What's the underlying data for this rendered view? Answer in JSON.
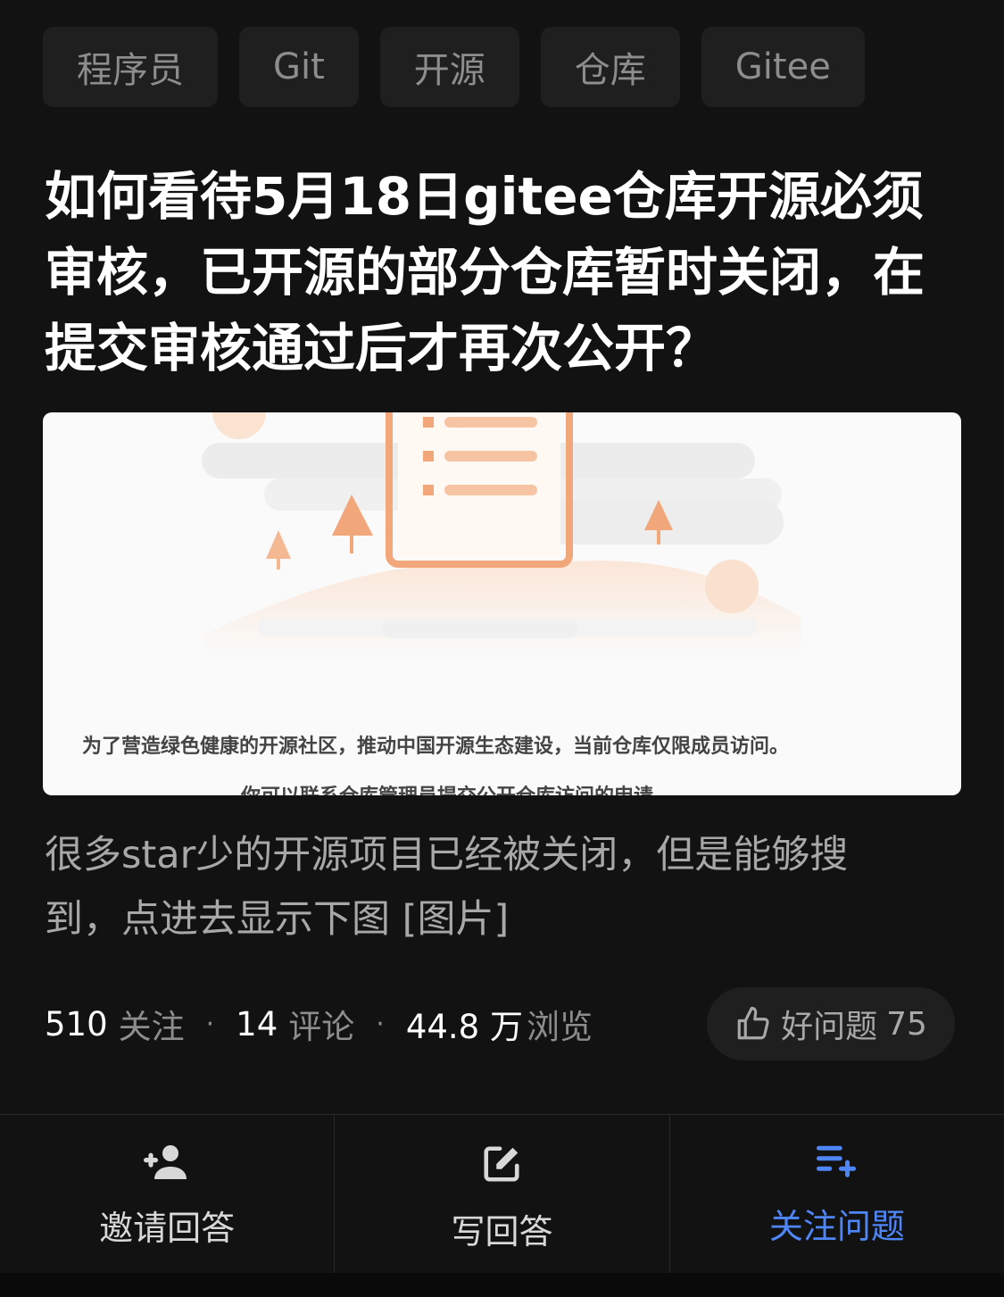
{
  "tags": [
    "程序员",
    "Git",
    "开源",
    "仓库",
    "Gitee"
  ],
  "question": {
    "title": "如何看待5月18日gitee仓库开源必须审核，已开源的部分仓库暂时关闭，在提交审核通过后才再次公开？"
  },
  "image": {
    "line1": "为了营造绿色健康的开源社区，推动中国开源生态建设，当前仓库仅限成员访问。",
    "line2": "你可以联系仓库管理员提交公开仓库访问的申请"
  },
  "excerpt": "很多star少的开源项目已经被关闭，但是能够搜到，点进去显示下图 [图片]",
  "stats": {
    "followers": "510",
    "followers_label": "关注",
    "comments": "14",
    "comments_label": "评论",
    "views": "44.8 万",
    "views_label": "浏览"
  },
  "good_question": {
    "label": "好问题",
    "count": "75"
  },
  "actions": {
    "invite": "邀请回答",
    "write": "写回答",
    "follow": "关注问题"
  },
  "colors": {
    "accent": "#4f86f7",
    "background": "#121212",
    "tag_bg": "#1f1f1f"
  },
  "icons": [
    "add-person-icon",
    "edit-icon",
    "list-add-icon",
    "thumbs-up-icon"
  ]
}
